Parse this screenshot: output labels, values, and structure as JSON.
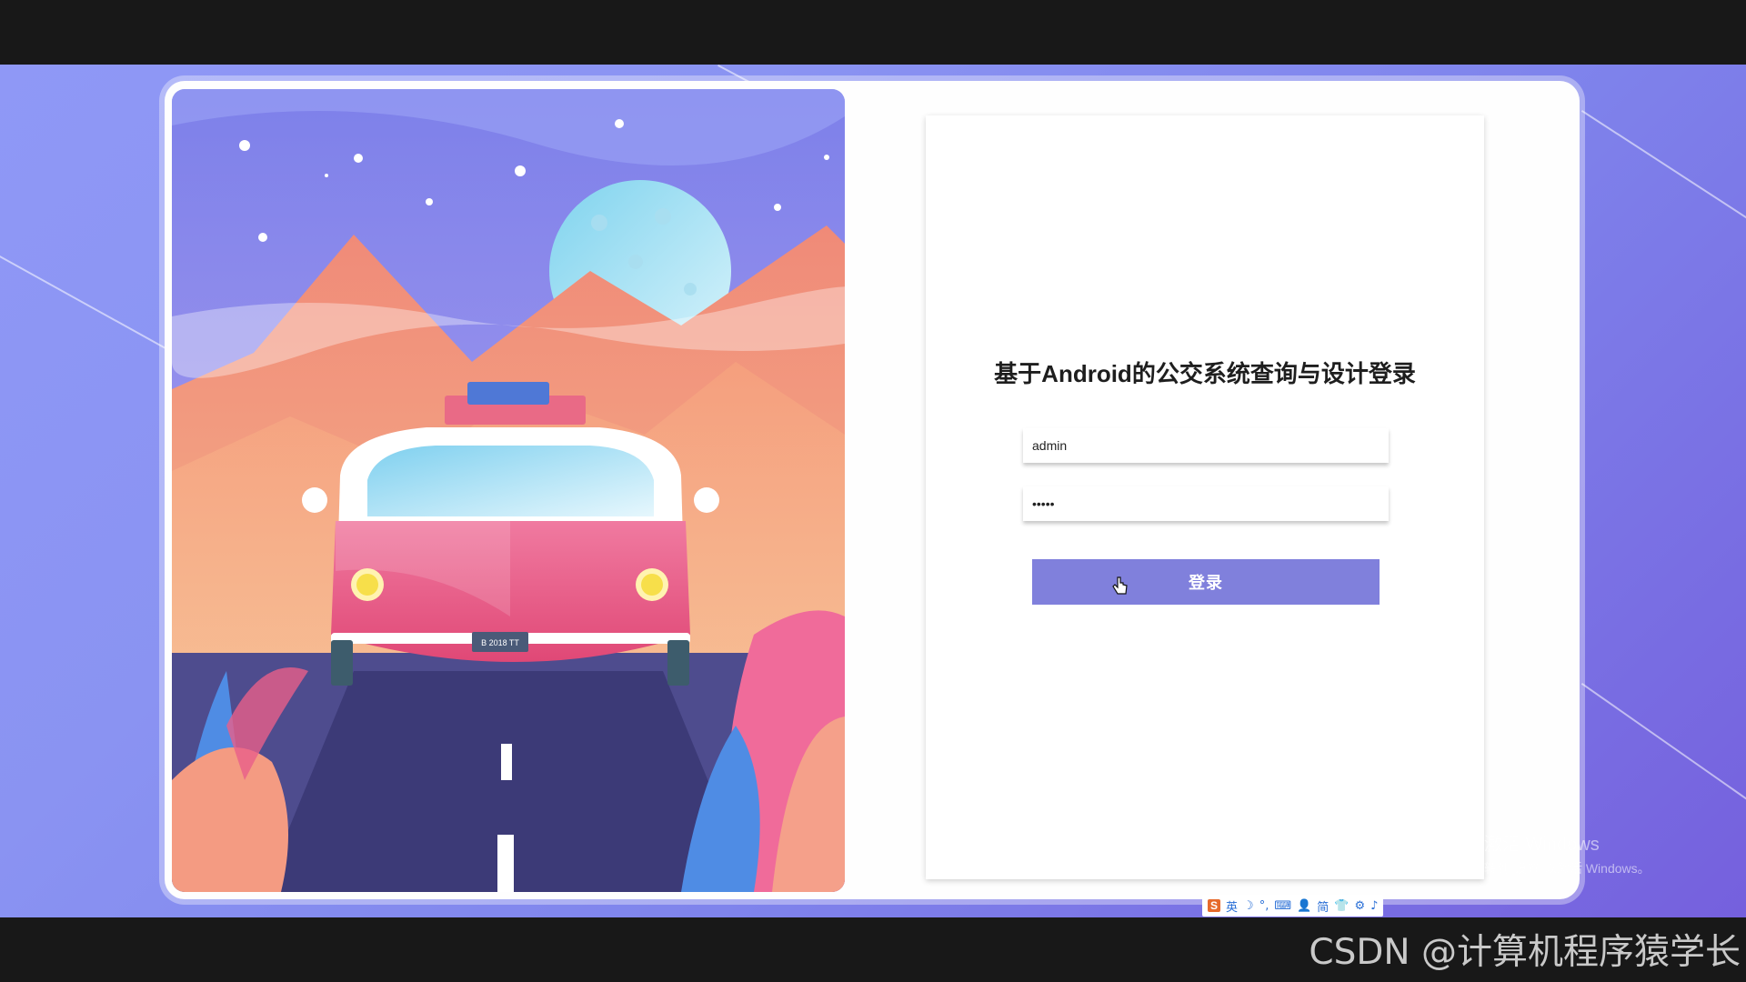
{
  "login": {
    "title": "基于Android的公交系统查询与设计登录",
    "username_value": "admin",
    "password_value": "•••••",
    "login_button_label": "登录"
  },
  "illustration": {
    "license_plate": "B 2018 TT"
  },
  "system": {
    "activate_windows_title": "激活 Windows",
    "activate_windows_sub": "转到\"设置\"以激活 Windows。"
  },
  "ime_toolbar": {
    "logo": "S",
    "items": [
      "英",
      "☽",
      "°,",
      "⌨",
      "👤",
      "简",
      "👕",
      "⚙",
      "♪"
    ]
  },
  "watermark": "CSDN @计算机程序猿学长",
  "colors": {
    "background": "#8a93f2",
    "button": "#8080dc",
    "card": "#fefefe"
  }
}
